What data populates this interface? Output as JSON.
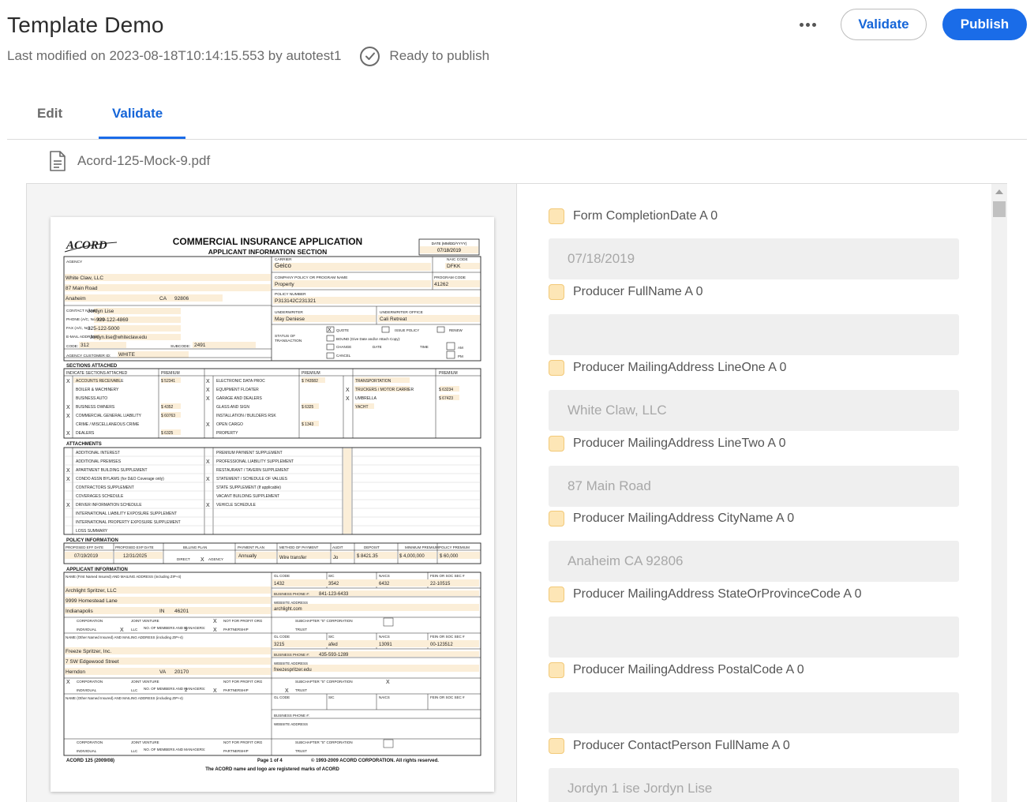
{
  "header": {
    "title": "Template Demo",
    "last_modified": "Last modified on 2023-08-18T10:14:15.553 by autotest1",
    "status": "Ready to publish",
    "validate_label": "Validate",
    "publish_label": "Publish"
  },
  "tabs": [
    {
      "label": "Edit",
      "active": false
    },
    {
      "label": "Validate",
      "active": true
    }
  ],
  "file": {
    "name": "Acord-125-Mock-9.pdf"
  },
  "colors": {
    "accent": "#1a6ce8",
    "field_marker": "#fde6b6"
  },
  "document": {
    "title": "COMMERCIAL INSURANCE APPLICATION",
    "section": "APPLICANT INFORMATION SECTION",
    "date_label": "DATE (MM/DD/YYYY)",
    "date_value": "07/18/2019",
    "agency_lines": [
      "White Claw, LLC",
      "87 Main Road",
      "Anaheim",
      "CA",
      "92806"
    ],
    "contact_name": "Jordyn Lise",
    "phone": "929-122-4869",
    "fax": "325-122-5000",
    "email": "Jordyn.lise@whiteclaw.edu",
    "code": "312",
    "subcode": "2491",
    "customer_id": "WHITE",
    "carrier": "Geico",
    "naic_code": "DFKK",
    "policy_program": "Property",
    "program_code": "41262",
    "policy_number": "P313142C231321",
    "underwriter": "May Deniese",
    "underwriter_office": "Cali Retreat",
    "footer_left": "ACORD 125 (2009/08)",
    "footer_center": "Page 1 of 4",
    "footer_right": "© 1993-2009 ACORD CORPORATION.  All rights reserved.",
    "footer_note": "The ACORD name and logo are registered marks of ACORD"
  },
  "fields": [
    {
      "label": "Form CompletionDate A 0",
      "value": "07/18/2019"
    },
    {
      "label": "Producer FullName A 0",
      "value": ""
    },
    {
      "label": "Producer MailingAddress LineOne A 0",
      "value": "White Claw, LLC"
    },
    {
      "label": "Producer MailingAddress LineTwo A 0",
      "value": "87 Main Road"
    },
    {
      "label": "Producer MailingAddress CityName A 0",
      "value": "Anaheim CA 92806"
    },
    {
      "label": "Producer MailingAddress StateOrProvinceCode A 0",
      "value": ""
    },
    {
      "label": "Producer MailingAddress PostalCode A 0",
      "value": ""
    },
    {
      "label": "Producer ContactPerson FullName A 0",
      "value": "Jordyn 1 ise Jordyn Lise"
    }
  ]
}
